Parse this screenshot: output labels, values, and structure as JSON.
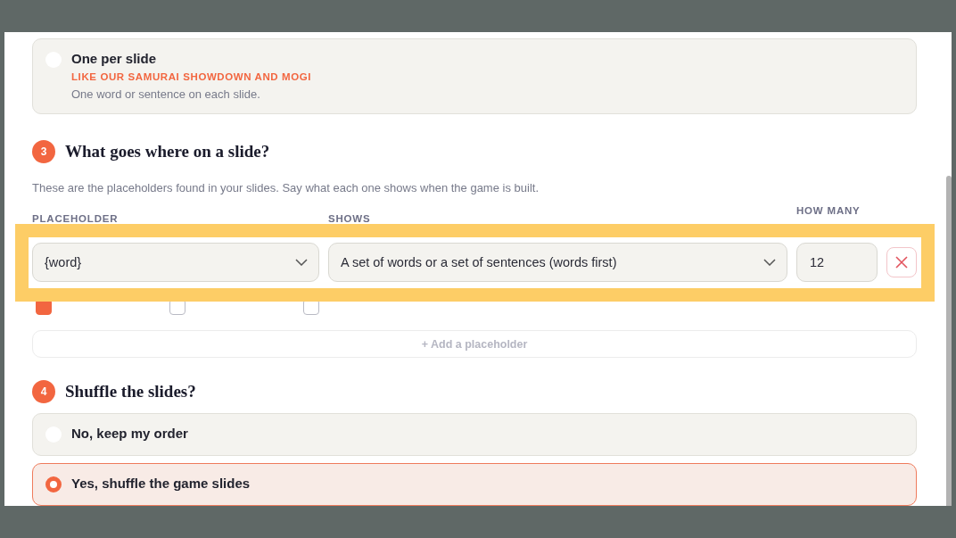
{
  "layout_option": {
    "title": "One per slide",
    "tagline": "LIKE OUR SAMURAI SHOWDOWN AND MOGI",
    "description": "One word or sentence on each slide.",
    "selected": false
  },
  "step3": {
    "number": "3",
    "title": "What goes where on a slide?",
    "description": "These are the placeholders found in your slides. Say what each one shows when the game is built.",
    "columns": [
      "PLACEHOLDER",
      "SHOWS",
      "HOW MANY"
    ],
    "rows": [
      {
        "placeholder": "{word}",
        "shows": "A set of words or a set of sentences (words first)",
        "count": "12",
        "highlighted": true,
        "options": [
          {
            "checked": true
          },
          {
            "checked": false
          },
          {
            "checked": false
          }
        ]
      }
    ],
    "add_button": "+ Add a placeholder"
  },
  "step4": {
    "number": "4",
    "title": "Shuffle the slides?",
    "options": [
      {
        "title": "No, keep my order",
        "selected": false
      },
      {
        "title": "Yes, shuffle the game slides",
        "selected": true
      }
    ]
  }
}
